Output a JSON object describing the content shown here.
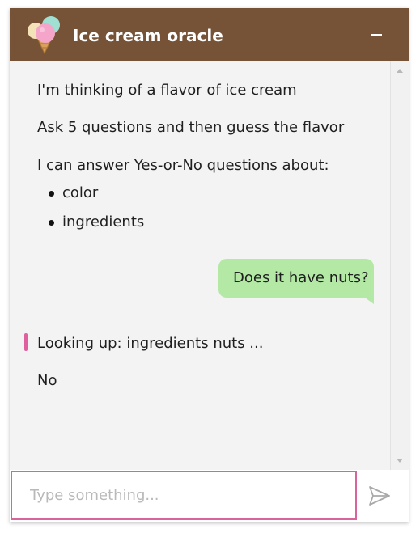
{
  "header": {
    "title": "Ice cream oracle",
    "logo": "ice-cream-cone-icon",
    "minimize_icon": "minimize-icon",
    "color": "#765337"
  },
  "messages": {
    "intro": "I'm thinking of a flavor of ice cream",
    "instructions": "Ask 5 questions and then guess the flavor",
    "topics_intro": "I can answer Yes-or-No questions about:",
    "topics": [
      "color",
      "ingredients"
    ],
    "user_question": "Does it have nuts?",
    "lookup": "Looking up: ingredients nuts ...",
    "answer": "No"
  },
  "input": {
    "placeholder": "Type something...",
    "value": "",
    "border_color": "#d9649b"
  },
  "send_icon": "send-icon",
  "colors": {
    "user_bubble": "#b3e8a5",
    "lookup_accent": "#e0609f",
    "panel_background": "#f3f3f3"
  }
}
